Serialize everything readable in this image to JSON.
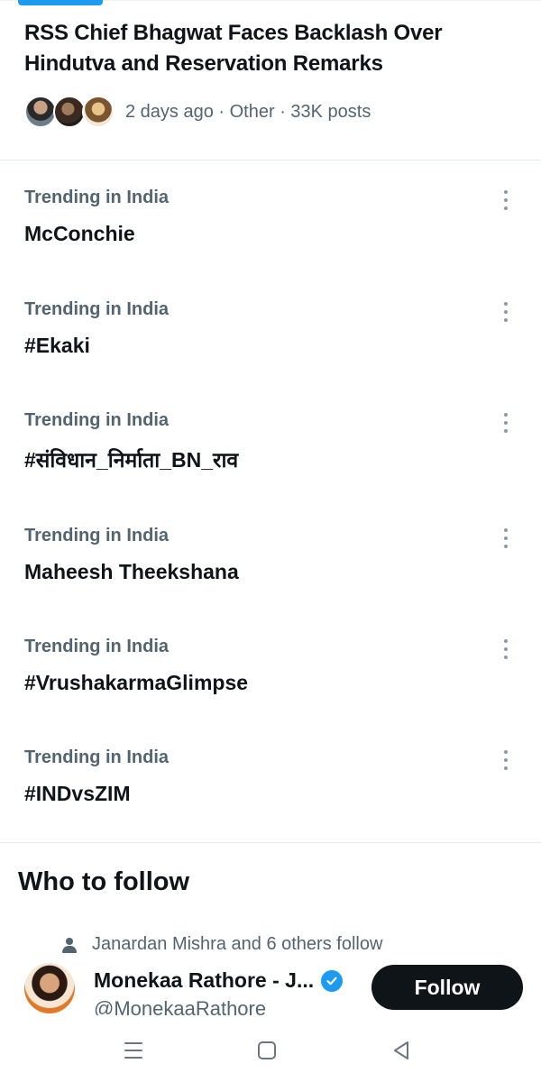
{
  "news": {
    "title": "RSS Chief Bhagwat Faces Backlash Over Hindutva and Reservation Remarks",
    "meta": "2 days ago · Other · 33K posts"
  },
  "trends": [
    {
      "context": "Trending in India",
      "name": "McConchie"
    },
    {
      "context": "Trending in India",
      "name": "#Ekaki"
    },
    {
      "context": "Trending in India",
      "name": "#संविधान_निर्माता_BN_राव"
    },
    {
      "context": "Trending in India",
      "name": "Maheesh Theekshana"
    },
    {
      "context": "Trending in India",
      "name": "#VrushakarmaGlimpse"
    },
    {
      "context": "Trending in India",
      "name": "#INDvsZIM"
    }
  ],
  "who_to_follow": {
    "title": "Who to follow",
    "followed_by": "Janardan Mishra and 6 others follow",
    "user": {
      "name": "Monekaa Rathore - J...",
      "handle": "@MonekaaRathore",
      "follow_label": "Follow"
    }
  },
  "colors": {
    "accent": "#1d9bf0",
    "secondary_text": "#536471",
    "follow_button": "#0f1419"
  },
  "icons": [
    "more-options-icon",
    "person-icon",
    "verified-badge-icon",
    "recents-icon",
    "home-icon",
    "back-icon"
  ]
}
